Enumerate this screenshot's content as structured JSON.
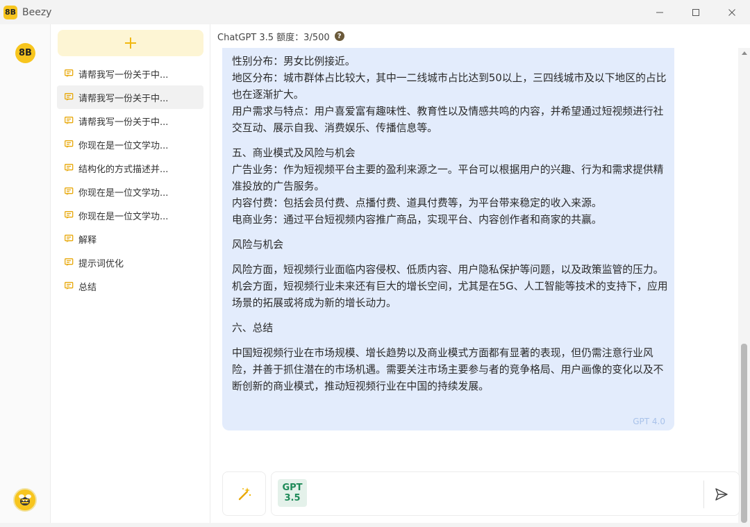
{
  "window": {
    "app_logo_text": "8B",
    "title": "Beezy"
  },
  "colors": {
    "brand": "#f7c51e",
    "bubble_bg": "#e3ecfc",
    "gpt_badge": "#1e8a58"
  },
  "icons": {
    "new_chat": "plus-icon",
    "conversation": "chat-bubble-icon",
    "help": "question-circle-icon",
    "magic": "magic-wand-icon",
    "send": "send-icon",
    "minimize": "minimize-icon",
    "maximize": "maximize-icon",
    "close": "close-icon"
  },
  "sidebar": {
    "conversations": [
      {
        "label": "请帮我写一份关于中..."
      },
      {
        "label": "请帮我写一份关于中..."
      },
      {
        "label": "请帮我写一份关于中..."
      },
      {
        "label": "你现在是一位文学功..."
      },
      {
        "label": "结构化的方式描述并..."
      },
      {
        "label": "你现在是一位文学功..."
      },
      {
        "label": "你现在是一位文学功..."
      },
      {
        "label": "解释"
      },
      {
        "label": "提示词优化"
      },
      {
        "label": "总结"
      }
    ]
  },
  "header": {
    "quota_text": "ChatGPT 3.5 额度：3/500",
    "help_glyph": "?"
  },
  "message": {
    "paragraphs": [
      "性别分布：男女比例接近。",
      "地区分布：城市群体占比较大，其中一二线城市占比达到50以上，三四线城市及以下地区的占比也在逐渐扩大。",
      "用户需求与特点：用户喜爱富有趣味性、教育性以及情感共鸣的内容，并希望通过短视频进行社交互动、展示自我、消费娱乐、传播信息等。",
      "五、商业模式及风险与机会",
      "广告业务：作为短视频平台主要的盈利来源之一。平台可以根据用户的兴趣、行为和需求提供精准投放的广告服务。",
      "内容付费：包括会员付费、点播付费、道具付费等，为平台带来稳定的收入来源。",
      "电商业务：通过平台短视频内容推广商品，实现平台、内容创作者和商家的共赢。",
      "风险与机会",
      "风险方面，短视频行业面临内容侵权、低质内容、用户隐私保护等问题，以及政策监管的压力。机会方面，短视频行业未来还有巨大的增长空间，尤其是在5G、人工智能等技术的支持下，应用场景的拓展或将成为新的增长动力。",
      "六、总结",
      "中国短视频行业在市场规模、增长趋势以及商业模式方面都有显著的表现，但仍需注意行业风险，并善于抓住潜在的市场机遇。需要关注市场主要参与者的竞争格局、用户画像的变化以及不断创新的商业模式，推动短视频行业在中国的持续发展。"
    ],
    "model_tag": "GPT 4.0"
  },
  "composer": {
    "model_badge_line1": "GPT",
    "model_badge_line2": "3.5"
  }
}
